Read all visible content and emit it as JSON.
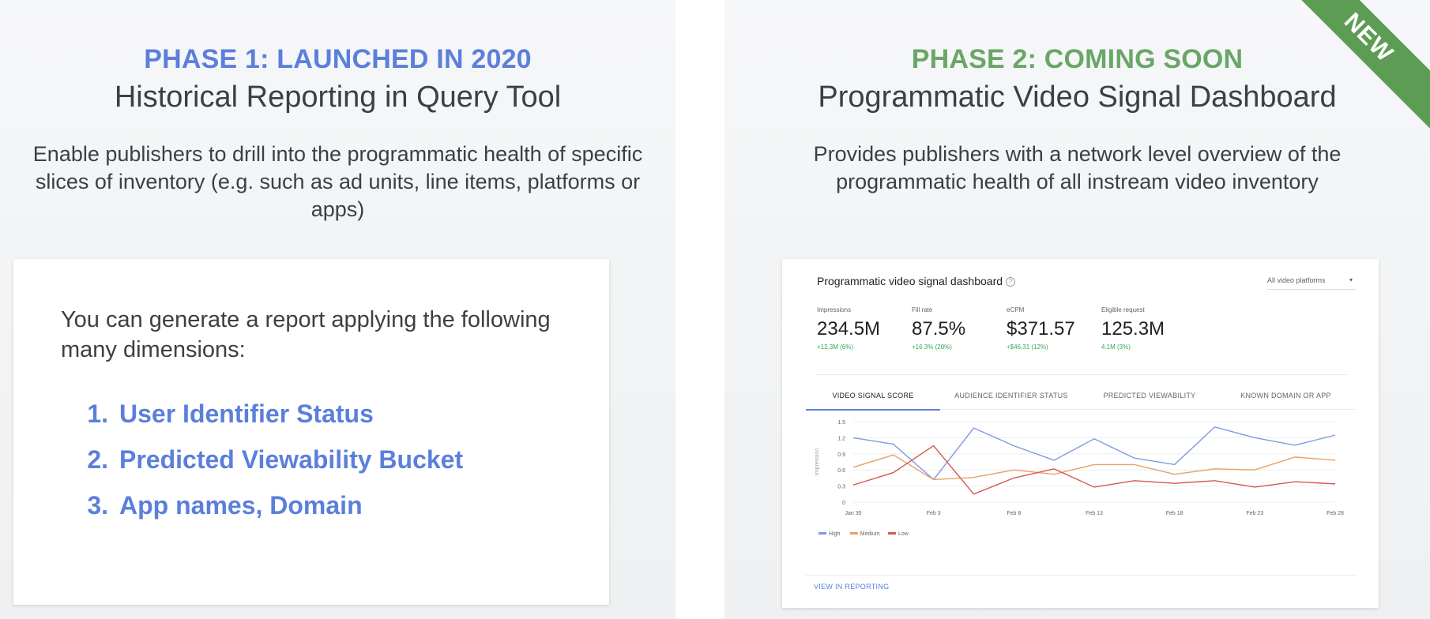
{
  "left_panel": {
    "phase_title": "PHASE 1: LAUNCHED IN 2020",
    "subtitle": "Historical Reporting in Query Tool",
    "description": "Enable publishers to drill into the programmatic health of specific slices of inventory (e.g. such as ad units, line items, platforms or apps)",
    "card": {
      "intro": "You can generate a report applying the following many dimensions:",
      "items": [
        {
          "num": "1.",
          "label": "User Identifier Status"
        },
        {
          "num": "2.",
          "label": "Predicted Viewability Bucket"
        },
        {
          "num": "3.",
          "label": "App names, Domain"
        }
      ]
    }
  },
  "right_panel": {
    "ribbon": "NEW",
    "phase_title": "PHASE 2: COMING SOON",
    "subtitle": "Programmatic Video Signal Dashboard",
    "description": "Provides publishers with a network level overview of the programmatic health of all instream video inventory",
    "dashboard": {
      "title": "Programmatic video signal dashboard",
      "help_icon": "?",
      "platform_select": "All video platforms",
      "platform_caret": "▾",
      "kpis": [
        {
          "label": "Impressions",
          "value": "234.5M",
          "delta": "+12.3M (6%)"
        },
        {
          "label": "Fill rate",
          "value": "87.5%",
          "delta": "+16.3% (20%)"
        },
        {
          "label": "eCPM",
          "value": "$371.57",
          "delta": "+$46.31 (12%)"
        },
        {
          "label": "Eligible request",
          "value": "125.3M",
          "delta": "4.1M (3%)"
        }
      ],
      "tabs": [
        "VIDEO SIGNAL SCORE",
        "AUDIENCE IDENTIFIER STATUS",
        "PREDICTED VIEWABILITY",
        "KNOWN DOMAIN OR APP"
      ],
      "active_tab": 0,
      "view_reporting": "VIEW IN REPORTING"
    }
  },
  "colors": {
    "phase1": "#5b7fdb",
    "phase2": "#6aa667",
    "ribbon": "#5d9c55",
    "high": "#7e9be0",
    "medium": "#e4a26a",
    "low": "#d6574f"
  },
  "chart_data": {
    "type": "line",
    "title": "",
    "xlabel": "",
    "ylabel": "Impression",
    "ylim": [
      0,
      1.5
    ],
    "yticks": [
      0,
      0.3,
      0.6,
      0.9,
      1.2,
      1.5
    ],
    "ytick_labels": [
      "0",
      "0.3",
      "0.6",
      "0.9",
      "1.2",
      "1.5"
    ],
    "xticks": [
      "Jan 30",
      "Feb 3",
      "Feb 8",
      "Feb 13",
      "Feb 18",
      "Feb 23",
      "Feb 28"
    ],
    "grid": true,
    "legend_position": "bottom-left",
    "x": [
      0,
      1,
      2,
      3,
      4,
      5,
      6,
      7,
      8,
      9,
      10,
      11,
      12
    ],
    "series": [
      {
        "name": "High",
        "color": "#7e9be0",
        "values": [
          1.2,
          1.08,
          0.42,
          1.38,
          1.05,
          0.78,
          1.18,
          0.82,
          0.7,
          1.4,
          1.2,
          1.06,
          1.25
        ]
      },
      {
        "name": "Medium",
        "color": "#e4a26a",
        "values": [
          0.65,
          0.88,
          0.42,
          0.46,
          0.6,
          0.52,
          0.7,
          0.7,
          0.52,
          0.62,
          0.6,
          0.84,
          0.78
        ]
      },
      {
        "name": "Low",
        "color": "#d6574f",
        "values": [
          0.32,
          0.55,
          1.05,
          0.15,
          0.45,
          0.62,
          0.28,
          0.4,
          0.35,
          0.4,
          0.28,
          0.38,
          0.34
        ]
      }
    ]
  }
}
